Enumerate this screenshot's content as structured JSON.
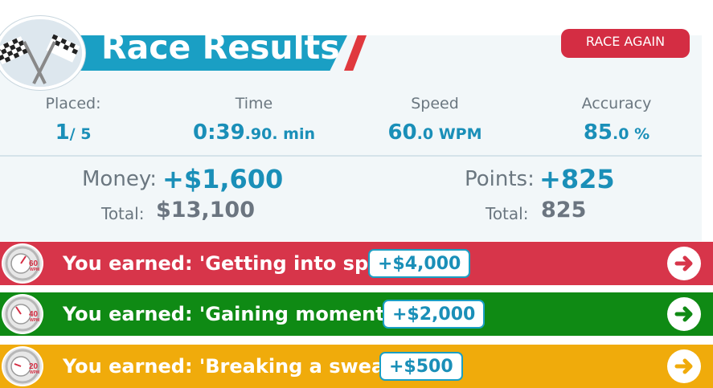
{
  "header": {
    "title": "Race Results",
    "race_again_label": "RACE AGAIN"
  },
  "stats": [
    {
      "label": "Placed:",
      "main": "1",
      "suffix": "/ 5"
    },
    {
      "label": "Time",
      "main": "0:39",
      "suffix": ".90",
      "unit": ". min"
    },
    {
      "label": "Speed",
      "main": "60",
      "suffix": ".0",
      "unit": " WPM"
    },
    {
      "label": "Accuracy",
      "main": "85",
      "suffix": ".0",
      "unit": " %"
    }
  ],
  "earnings": {
    "money_label": "Money:",
    "money_value": "+$1,600",
    "money_total_label": "Total:",
    "money_total": "$13,100",
    "points_label": "Points:",
    "points_value": "+825",
    "points_total_label": "Total:",
    "points_total": "825"
  },
  "achievements": [
    {
      "text": "You earned: 'Getting into speed'",
      "reward": "+$4,000",
      "badge_wpm": "60",
      "badge_unit": "WPM",
      "color": "#d7354a"
    },
    {
      "text": "You earned: 'Gaining momentum'",
      "reward": "+$2,000",
      "badge_wpm": "40",
      "badge_unit": "WPM",
      "color": "#0f8a14"
    },
    {
      "text": "You earned: 'Breaking a sweat'",
      "reward": "+$500",
      "badge_wpm": "20",
      "badge_unit": "WPM",
      "color": "#f0ab0b"
    }
  ],
  "colors": {
    "accent": "#1a9fc4",
    "race_again": "#d42d43",
    "achievement_red": "#d7354a",
    "achievement_green": "#0f8a14",
    "achievement_yellow": "#f0ab0b"
  }
}
